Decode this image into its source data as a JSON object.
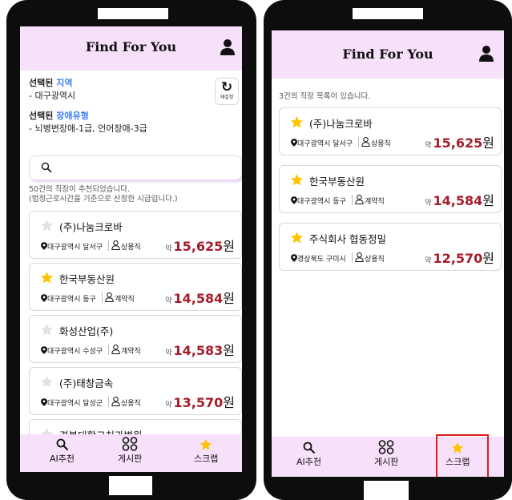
{
  "app_title": "Find For You",
  "left": {
    "selected_region_prefix": "선택된",
    "selected_region_word": "지역",
    "selected_region_value": "- 대구광역시",
    "selected_disability_prefix": "선택된",
    "selected_disability_word": "장애유형",
    "selected_disability_value": "- 뇌병변장애-1급, 언어장애-3급",
    "reset_label": "재설정",
    "search_placeholder": "",
    "count_line1": "50건의 직장이 추천되었습니다.",
    "count_line2": "(법정근로시간을 기준으로 산정한 시급입니다.)",
    "cards": [
      {
        "name": "(주)나눔크로바",
        "location": "대구광역시 달서구",
        "job_type": "상용직",
        "wage_prefix": "약",
        "wage": "15,625",
        "wage_unit": "원",
        "starred": false
      },
      {
        "name": "한국부동산원",
        "location": "대구광역시 동구",
        "job_type": "계약직",
        "wage_prefix": "약",
        "wage": "14,584",
        "wage_unit": "원",
        "starred": true
      },
      {
        "name": "화성산업(주)",
        "location": "대구광역시 수성구",
        "job_type": "계약직",
        "wage_prefix": "약",
        "wage": "14,583",
        "wage_unit": "원",
        "starred": false
      },
      {
        "name": "(주)태창금속",
        "location": "대구광역시 달성군",
        "job_type": "상용직",
        "wage_prefix": "약",
        "wage": "13,570",
        "wage_unit": "원",
        "starred": false
      },
      {
        "name": "경북대학교치과병원",
        "location": "",
        "job_type": "",
        "wage_prefix": "",
        "wage": "",
        "wage_unit": "",
        "starred": false
      }
    ]
  },
  "right": {
    "count_text": "3건의 직장 목록이 있습니다.",
    "cards": [
      {
        "name": "(주)나눔크로바",
        "location": "대구광역시 달서구",
        "job_type": "상용직",
        "wage_prefix": "약",
        "wage": "15,625",
        "wage_unit": "원",
        "starred": true
      },
      {
        "name": "한국부동산원",
        "location": "대구광역시 동구",
        "job_type": "계약직",
        "wage_prefix": "약",
        "wage": "14,584",
        "wage_unit": "원",
        "starred": true
      },
      {
        "name": "주식회사 협동정밀",
        "location": "경상북도 구미시",
        "job_type": "상용직",
        "wage_prefix": "약",
        "wage": "12,570",
        "wage_unit": "원",
        "starred": true
      }
    ]
  },
  "nav": {
    "ai_label": "AI추천",
    "board_label": "게시판",
    "scrap_label": "스크랩"
  },
  "colors": {
    "header_bg": "#f7e0fa",
    "accent_blue": "#3d7df0",
    "wage_red": "#a31d2a",
    "star_gold": "#ffc400",
    "star_grey": "#e2e2e2",
    "highlight_red": "#e11b1b"
  }
}
